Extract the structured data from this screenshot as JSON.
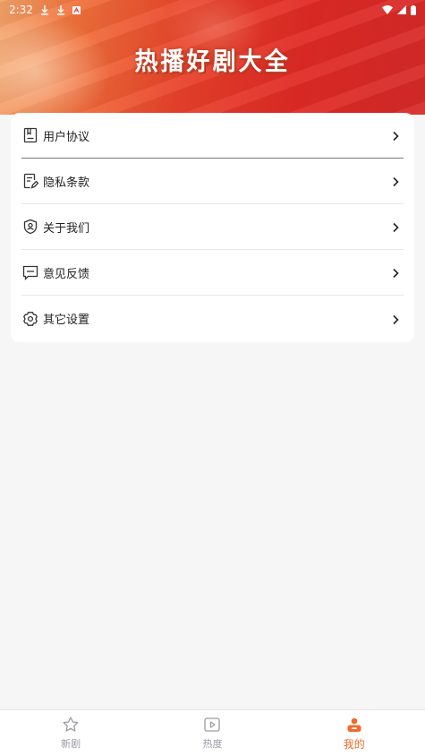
{
  "status_bar": {
    "time": "2:32"
  },
  "banner": {
    "title": "热播好剧大全"
  },
  "menu": {
    "items": [
      {
        "label": "用户协议",
        "icon": "document-icon"
      },
      {
        "label": "隐私条款",
        "icon": "edit-document-icon"
      },
      {
        "label": "关于我们",
        "icon": "shield-user-icon"
      },
      {
        "label": "意见反馈",
        "icon": "message-icon"
      },
      {
        "label": "其它设置",
        "icon": "settings-icon"
      }
    ]
  },
  "tabs": [
    {
      "label": "新剧",
      "icon": "star-icon",
      "active": false
    },
    {
      "label": "热度",
      "icon": "play-square-icon",
      "active": false
    },
    {
      "label": "我的",
      "icon": "user-icon",
      "active": true
    }
  ],
  "colors": {
    "accent": "#f06a2a",
    "banner_red": "#e02a24",
    "inactive_tab": "#9a9aa5"
  }
}
